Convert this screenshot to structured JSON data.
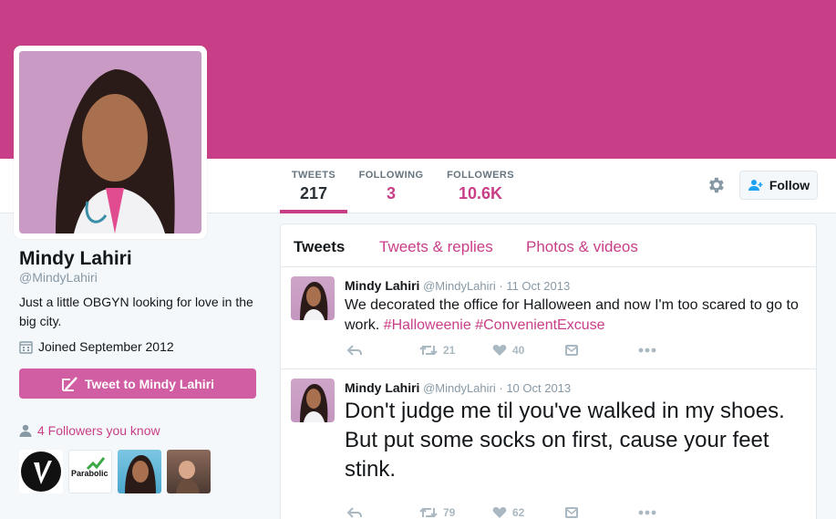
{
  "colors": {
    "brand": "#c83e87",
    "banner": "#c83e87",
    "button": "#d15ea2"
  },
  "nav": {
    "tweets": {
      "label": "TWEETS",
      "count": "217"
    },
    "following": {
      "label": "FOLLOWING",
      "count": "3"
    },
    "followers": {
      "label": "FOLLOWERS",
      "count": "10.6K"
    },
    "follow_button": "Follow"
  },
  "profile": {
    "name": "Mindy Lahiri",
    "handle": "@MindyLahiri",
    "bio": "Just a little OBGYN looking for love in the big city.",
    "joined": "Joined September 2012",
    "tweet_to_button": "Tweet to Mindy Lahiri",
    "followers_you_know": "4 Followers you know",
    "followers_thumbs": [
      "Parabolic"
    ]
  },
  "tabs": [
    "Tweets",
    "Tweets & replies",
    "Photos & videos"
  ],
  "tweets": [
    {
      "name": "Mindy Lahiri",
      "handle": "@MindyLahiri",
      "date": "· 11 Oct 2013",
      "text": "We decorated the office for Halloween and now I'm too scared to go to work.",
      "hashtags": [
        "#Halloweenie",
        "#ConvenientExcuse"
      ],
      "retweets": "21",
      "likes": "40"
    },
    {
      "name": "Mindy Lahiri",
      "handle": "@MindyLahiri",
      "date": "· 10 Oct 2013",
      "text": "Don't judge me til you've walked in my shoes. But put some socks on first, cause your feet stink.",
      "retweets": "79",
      "likes": "62"
    }
  ]
}
